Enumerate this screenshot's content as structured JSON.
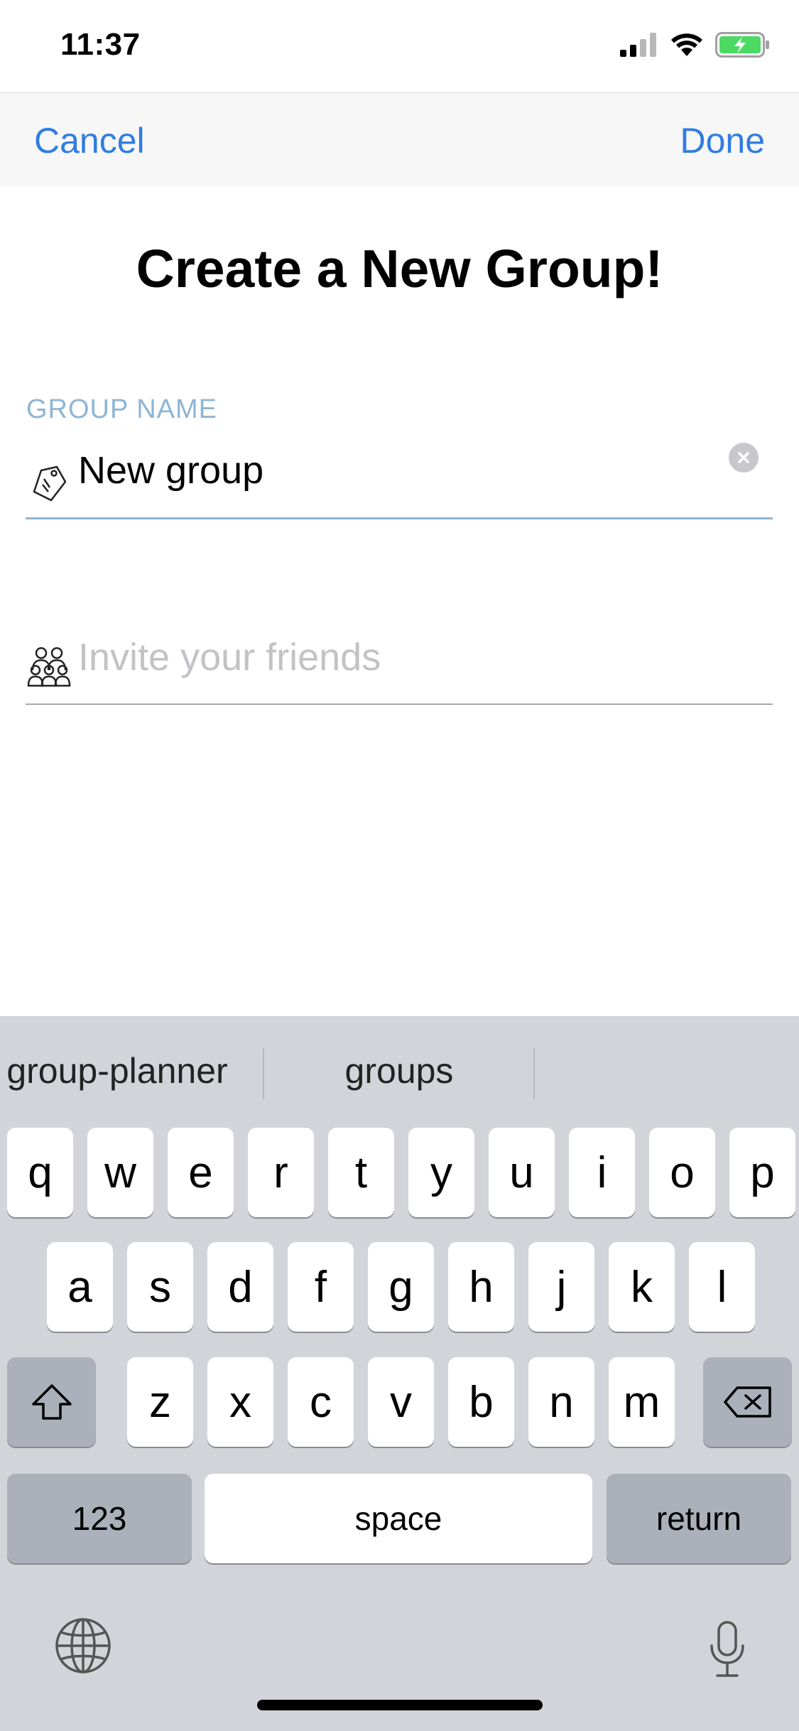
{
  "status_bar": {
    "time": "11:37",
    "icons": [
      "cellular-signal-icon",
      "wifi-icon",
      "battery-charging-icon"
    ],
    "battery_color": "#4cd964"
  },
  "nav": {
    "cancel_label": "Cancel",
    "done_label": "Done",
    "accent_color": "#2f7de1"
  },
  "title": "Create a New Group!",
  "group_name": {
    "label": "GROUP NAME",
    "value": "New group",
    "icon": "tag-icon",
    "clear_icon": "clear-circle-icon"
  },
  "invite": {
    "placeholder": "Invite your friends",
    "icon": "group-people-icon"
  },
  "keyboard": {
    "suggestions": [
      "group-planner",
      "groups",
      ""
    ],
    "row1": [
      "q",
      "w",
      "e",
      "r",
      "t",
      "y",
      "u",
      "i",
      "o",
      "p"
    ],
    "row2": [
      "a",
      "s",
      "d",
      "f",
      "g",
      "h",
      "j",
      "k",
      "l"
    ],
    "row3": [
      "z",
      "x",
      "c",
      "v",
      "b",
      "n",
      "m"
    ],
    "numbers_label": "123",
    "space_label": "space",
    "return_label": "return",
    "shift_icon": "shift-icon",
    "delete_icon": "backspace-icon",
    "globe_icon": "globe-icon",
    "mic_icon": "microphone-icon"
  }
}
